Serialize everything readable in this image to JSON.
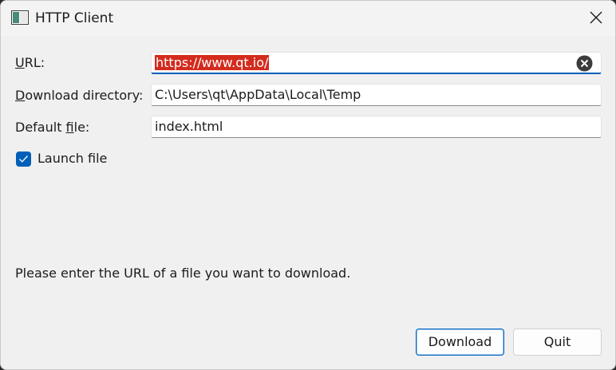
{
  "window": {
    "title": "HTTP Client"
  },
  "form": {
    "url_label_pre": "",
    "url_label_mnemonic": "U",
    "url_label_post": "RL:",
    "url_value": "https://www.qt.io/",
    "dir_label_mnemonic": "D",
    "dir_label_post": "ownload directory:",
    "dir_value": "C:\\Users\\qt\\AppData\\Local\\Temp",
    "file_label_pre": "Default ",
    "file_label_mnemonic": "f",
    "file_label_post": "ile:",
    "file_value": "index.html",
    "launch_label": "Launch file",
    "launch_checked": true
  },
  "status_text": "Please enter the URL of a file you want to download.",
  "buttons": {
    "download": "Download",
    "quit": "Quit"
  },
  "colors": {
    "accent": "#005fb8",
    "selection": "#d32b1d"
  }
}
